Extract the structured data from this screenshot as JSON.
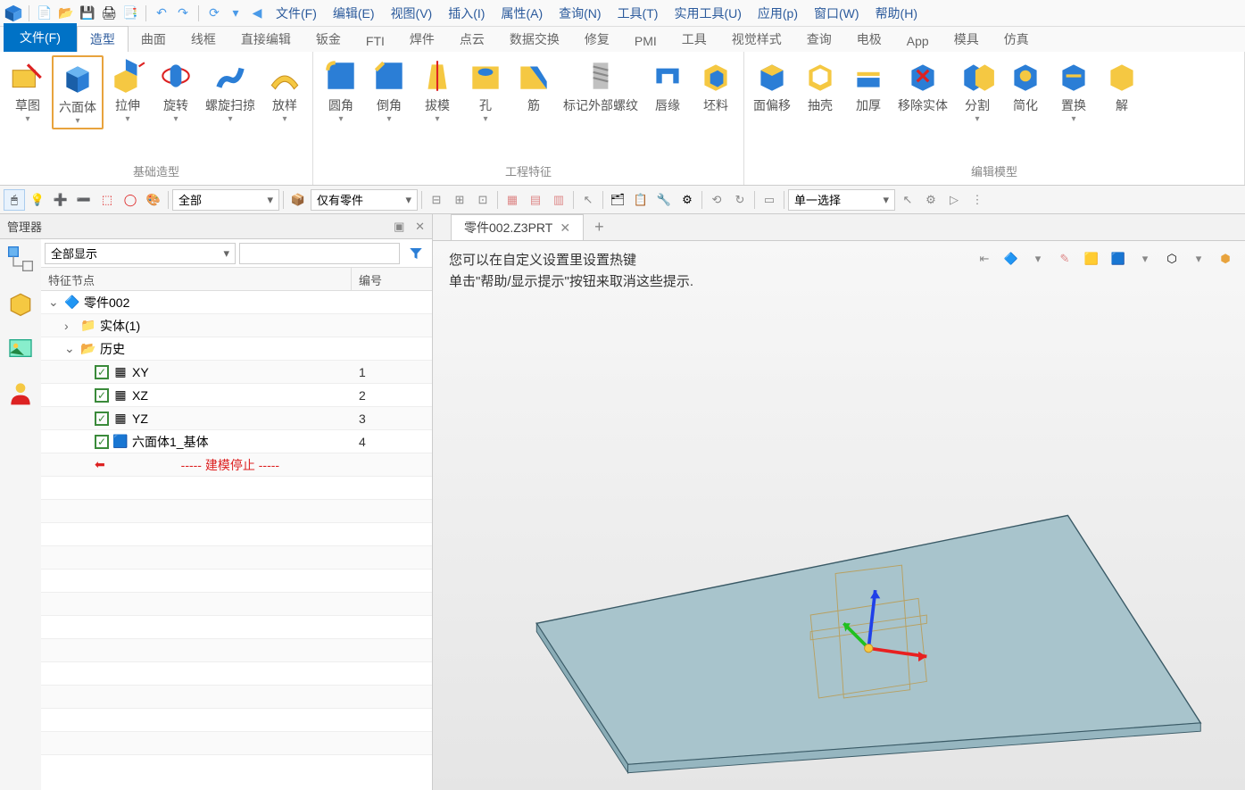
{
  "menus": [
    "文件(F)",
    "编辑(E)",
    "视图(V)",
    "插入(I)",
    "属性(A)",
    "查询(N)",
    "工具(T)",
    "实用工具(U)",
    "应用(p)",
    "窗口(W)",
    "帮助(H)"
  ],
  "ribbon_tabs": {
    "file": "文件(F)",
    "active": "造型",
    "others": [
      "曲面",
      "线框",
      "直接编辑",
      "钣金",
      "FTI",
      "焊件",
      "点云",
      "数据交换",
      "修复",
      "PMI",
      "工具",
      "视觉样式",
      "查询",
      "电极",
      "App",
      "模具",
      "仿真"
    ]
  },
  "ribbon": {
    "group1": {
      "label": "基础造型",
      "items": [
        "草图",
        "六面体",
        "拉伸",
        "旋转",
        "螺旋扫掠",
        "放样"
      ]
    },
    "group2": {
      "label": "工程特征",
      "items": [
        "圆角",
        "倒角",
        "拔模",
        "孔",
        "筋",
        "标记外部螺纹",
        "唇缘",
        "坯料"
      ]
    },
    "group3": {
      "label": "编辑模型",
      "items": [
        "面偏移",
        "抽壳",
        "加厚",
        "移除实体",
        "分割",
        "简化",
        "置换",
        "解"
      ]
    }
  },
  "toolbar": {
    "select1": "全部",
    "select2": "仅有零件",
    "select3": "单一选择"
  },
  "manager": {
    "title": "管理器",
    "filter": "全部显示",
    "headers": {
      "col1": "特征节点",
      "col2": "编号"
    },
    "tree": {
      "root": "零件002",
      "solid": "实体(1)",
      "history": "历史",
      "items": [
        {
          "name": "XY",
          "num": "1"
        },
        {
          "name": "XZ",
          "num": "2"
        },
        {
          "name": "YZ",
          "num": "3"
        },
        {
          "name": "六面体1_基体",
          "num": "4"
        }
      ],
      "stop": "----- 建模停止 -----"
    }
  },
  "viewport": {
    "tab": "零件002.Z3PRT",
    "hint1": "您可以在自定义设置里设置热键",
    "hint2": "单击\"帮助/显示提示\"按钮来取消这些提示."
  }
}
